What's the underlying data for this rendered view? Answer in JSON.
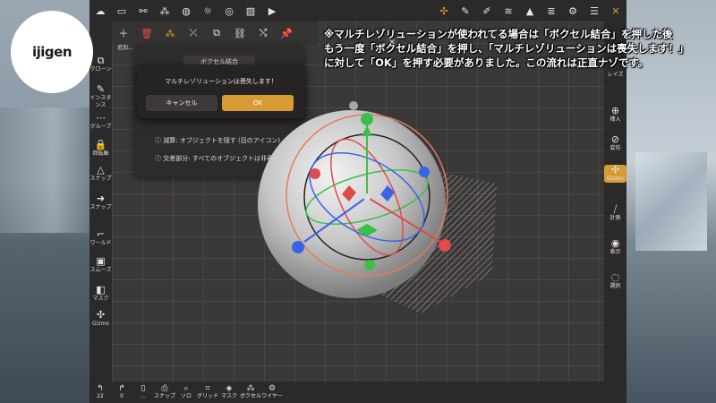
{
  "overlay": {
    "logo_text": "ijigen",
    "caption_lines": [
      "※マルチレゾリューションが使われてる場合は「ボクセル結合」を押した後",
      "もう一度「ボクセル結合」を押し、「マルチレゾリューションは喪失します！」",
      "に対して「OK」を押す必要がありました。この流れは正直ナゾです。"
    ]
  },
  "toolrow": {
    "add_label": "追加..."
  },
  "left_toolbar": [
    {
      "icon": "clone-icon",
      "glyph": "⧉",
      "label": "クローン"
    },
    {
      "icon": "instance-icon",
      "glyph": "✎",
      "label": "インスタンス"
    },
    {
      "icon": "group-icon",
      "glyph": "⋯",
      "label": "グループ"
    },
    {
      "icon": "lock-icon",
      "glyph": "🔒",
      "label": "回転軸"
    },
    {
      "icon": "snap-icon",
      "glyph": "△",
      "label": "スナップ"
    },
    {
      "icon": "arrow-icon",
      "glyph": "➜",
      "label": "スナップ"
    },
    {
      "icon": "world-icon",
      "glyph": "⌐",
      "label": "ワールド"
    },
    {
      "icon": "smooth-icon",
      "glyph": "▣",
      "label": "スムーズ"
    },
    {
      "icon": "mask-icon",
      "glyph": "◧",
      "label": "マスク"
    },
    {
      "icon": "gizmo-icon",
      "glyph": "✣",
      "label": "Gizmo"
    }
  ],
  "right_toolbar": [
    {
      "icon": "ray-icon",
      "glyph": "",
      "label": "レイズ"
    },
    {
      "icon": "insert-icon",
      "glyph": "⊕",
      "label": "挿入"
    },
    {
      "icon": "transform-icon",
      "glyph": "⊘",
      "label": "変形"
    },
    {
      "icon": "gizmo-icon",
      "glyph": "✣",
      "label": "Gizmo",
      "active": true
    },
    {
      "icon": "measure-icon",
      "glyph": "⧸",
      "label": "計測"
    },
    {
      "icon": "camera-icon",
      "glyph": "◉",
      "label": "表示"
    },
    {
      "icon": "select-icon",
      "glyph": "◌",
      "label": "選択"
    }
  ],
  "bottom_toolbar": [
    {
      "icon": "undo-icon",
      "glyph": "↰",
      "label": "22"
    },
    {
      "icon": "redo-icon",
      "glyph": "↱",
      "label": "0"
    },
    {
      "icon": "doc-icon",
      "glyph": "▯",
      "label": "..."
    },
    {
      "icon": "snapshot-icon",
      "glyph": "⎙",
      "label": "スナップ"
    },
    {
      "icon": "solo-icon",
      "glyph": "⌕",
      "label": "ソロ"
    },
    {
      "icon": "grid-icon",
      "glyph": "⌗",
      "label": "グリッド"
    },
    {
      "icon": "mask-icon",
      "glyph": "◈",
      "label": "マスク"
    },
    {
      "icon": "voxel-icon",
      "glyph": "⁂",
      "label": "ボクセル"
    },
    {
      "icon": "wire-icon",
      "glyph": "⚙",
      "label": "ワイヤー"
    }
  ],
  "panel": {
    "title": "ボクセル結合",
    "info1": "減算: オブジェクトを隠す (目のアイコン)",
    "info2": "交差部分: すべてのオブジェクトは非表示です"
  },
  "alert": {
    "message": "マルチレゾリューションは喪失します！",
    "cancel_label": "キャンセル",
    "ok_label": "OK"
  },
  "colors": {
    "accent": "#d69c33",
    "panel_bg": "#2e2b2b",
    "toolbar_bg": "#2b2929"
  }
}
